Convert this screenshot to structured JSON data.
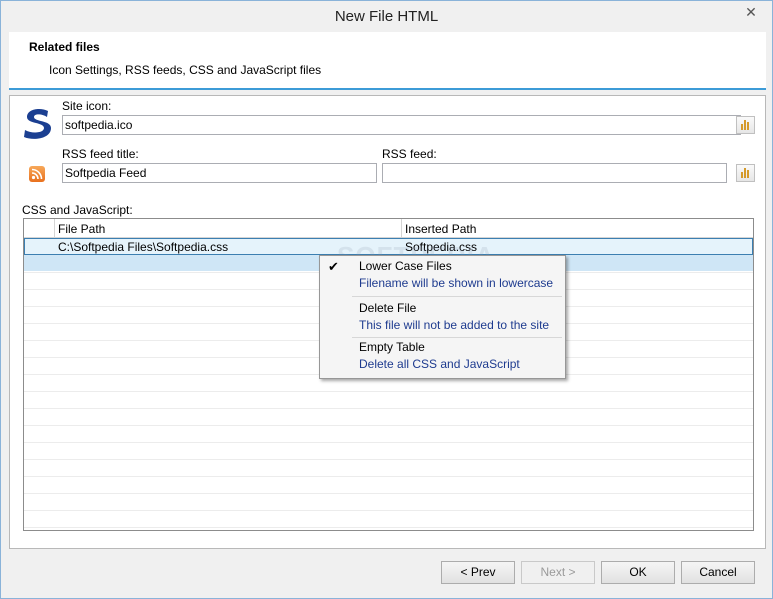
{
  "window": {
    "title": "New File HTML"
  },
  "header": {
    "title": "Related files",
    "subtitle": "Icon Settings, RSS feeds, CSS and JavaScript files"
  },
  "site_icon": {
    "label": "Site icon:",
    "value": "softpedia.ico"
  },
  "rss_title": {
    "label": "RSS feed title:",
    "value": "Softpedia Feed"
  },
  "rss_feed": {
    "label": "RSS feed:",
    "value": ""
  },
  "css_js": {
    "label": "CSS and JavaScript:",
    "columns": [
      "File Path",
      "Inserted Path"
    ],
    "rows": [
      {
        "file_path": "C:\\Softpedia Files\\Softpedia.css",
        "inserted_path": "Softpedia.css"
      }
    ]
  },
  "context_menu": {
    "items": [
      {
        "title": "Lower Case Files",
        "description": "Filename will be shown in lowercase",
        "checked": true
      },
      {
        "title": "Delete File",
        "description": "This file will not be added to the site"
      },
      {
        "title": "Empty Table",
        "description": "Delete all CSS and JavaScript"
      }
    ]
  },
  "buttons": {
    "prev": "< Prev",
    "next": "Next >",
    "ok": "OK",
    "cancel": "Cancel"
  },
  "watermark": "SOFTPEDIA",
  "colors": {
    "accent": "#3c9bd7",
    "menu_desc": "#1e3b8f",
    "selection": "#e5f3fb"
  }
}
